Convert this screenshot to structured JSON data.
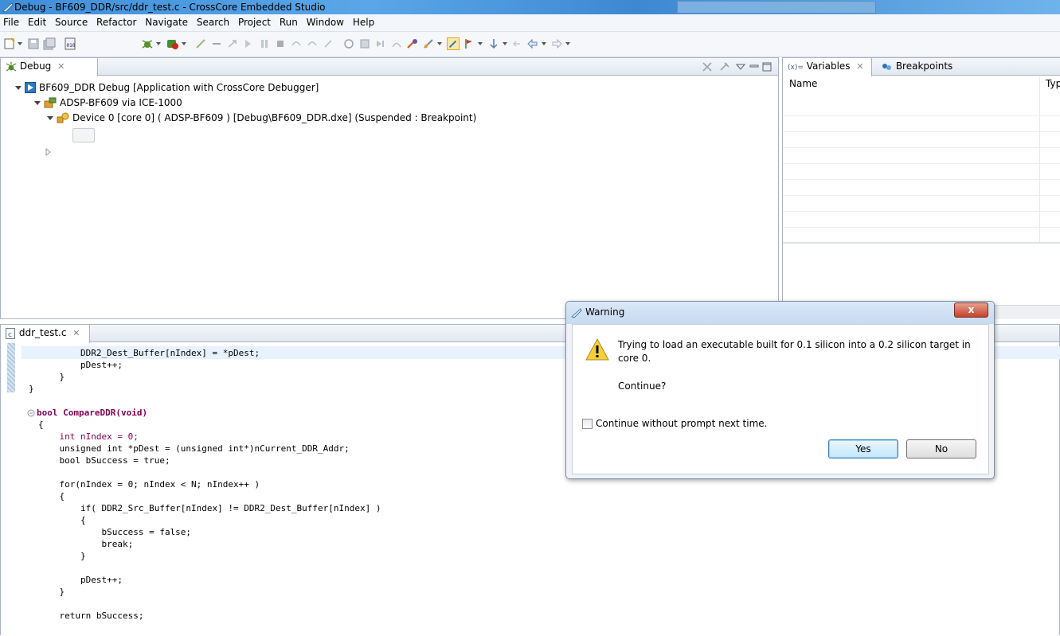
{
  "window": {
    "title": "Debug - BF609_DDR/src/ddr_test.c - CrossCore Embedded Studio"
  },
  "menu": [
    "File",
    "Edit",
    "Source",
    "Refactor",
    "Navigate",
    "Search",
    "Project",
    "Run",
    "Window",
    "Help"
  ],
  "debug_view": {
    "tab_label": "Debug",
    "launch": "BF609_DDR Debug [Application with CrossCore Debugger]",
    "target": "ADSP-BF609 via ICE-1000",
    "device": "Device 0 [core 0] ( ADSP-BF609 ) [Debug\\BF609_DDR.dxe] (Suspended : Breakpoint)"
  },
  "variables_view": {
    "tab_variables": "Variables",
    "tab_breakpoints": "Breakpoints",
    "col_name": "Name",
    "col_type": "Typ"
  },
  "editor": {
    "tab_label": "ddr_test.c",
    "lines": [
      "        DDR2_Dest_Buffer[nIndex] = *pDest;",
      "        pDest++;",
      "    }",
      "}",
      "",
      "bool CompareDDR(void)",
      "{",
      "    int nIndex = 0;",
      "    unsigned int *pDest = (unsigned int*)nCurrent_DDR_Addr;",
      "    bool bSuccess = true;",
      "",
      "    for(nIndex = 0; nIndex < N; nIndex++ )",
      "    {",
      "        if( DDR2_Src_Buffer[nIndex] != DDR2_Dest_Buffer[nIndex] )",
      "        {",
      "            bSuccess = false;",
      "            break;",
      "        }",
      "",
      "        pDest++;",
      "    }",
      "",
      "    return bSuccess;"
    ]
  },
  "dialog": {
    "title": "Warning",
    "close": "x",
    "message": "Trying to load an executable built for 0.1 silicon into a 0.2 silicon target in core 0.",
    "message_line1": "Trying to load an executable built for 0.1 silicon into a 0.2 silicon target in",
    "message_line2": "core 0.",
    "question": "Continue?",
    "checkbox_label": "Continue without prompt next time.",
    "yes_label": "Yes",
    "no_label": "No"
  },
  "colors": {
    "accent": "#3c7fb1",
    "titlebar": "#4a96dd",
    "pane_border": "#a8b3c2"
  },
  "icons": [
    "debug-icon",
    "launch-icon",
    "target-icon",
    "device-icon",
    "file-c-icon",
    "variables-icon",
    "breakpoints-icon",
    "warning-icon",
    "close-icon"
  ]
}
